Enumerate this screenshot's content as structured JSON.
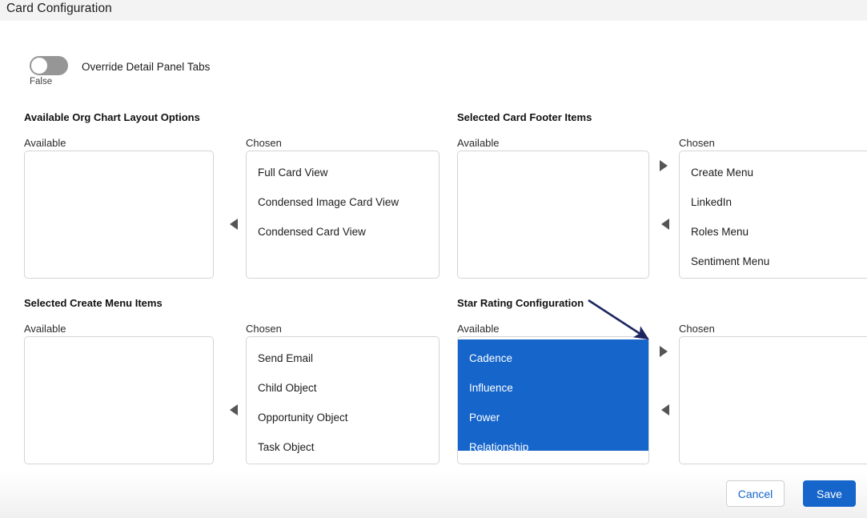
{
  "header": {
    "title": "Card Configuration"
  },
  "toggle": {
    "name": "override-detail-panel-tabs",
    "label": "Override Detail Panel Tabs",
    "state_text": "False",
    "checked": false
  },
  "labels": {
    "available": "Available",
    "chosen": "Chosen"
  },
  "arrows": {
    "move_right": "move-right",
    "move_left": "move-left"
  },
  "sections": [
    {
      "id": "available-org-chart-layout-options",
      "title": "Available Org Chart Layout Options",
      "available_items": [],
      "chosen_items": [
        "Full Card View",
        "Condensed Image Card View",
        "Condensed Card View"
      ],
      "highlighted": false
    },
    {
      "id": "selected-card-footer-items",
      "title": "Selected Card Footer Items",
      "available_items": [],
      "chosen_items": [
        "Create Menu",
        "LinkedIn",
        "Roles Menu",
        "Sentiment Menu"
      ],
      "highlighted": false
    },
    {
      "id": "selected-create-menu-items",
      "title": "Selected Create Menu Items",
      "available_items": [],
      "chosen_items": [
        "Send Email",
        "Child Object",
        "Opportunity Object",
        "Task Object"
      ],
      "highlighted": false
    },
    {
      "id": "star-rating-configuration",
      "title": "Star Rating Configuration",
      "available_items": [
        "Cadence",
        "Influence",
        "Power",
        "Relationship"
      ],
      "chosen_items": [],
      "highlighted": true
    }
  ],
  "footer": {
    "cancel_label": "Cancel",
    "save_label": "Save"
  },
  "colors": {
    "accent_blue": "#1565cb",
    "header_bar": "#f3f3f3",
    "annotation_arrow": "#1b2560",
    "toggle_off": "#969696",
    "border": "#d4d4d4"
  }
}
